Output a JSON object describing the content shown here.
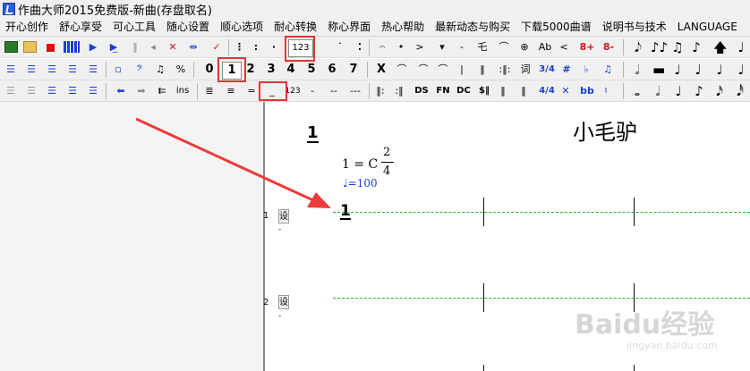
{
  "window": {
    "title": "作曲大师2015免费版-新曲(存盘取名)"
  },
  "menu": {
    "items": [
      "开心创作",
      "舒心享受",
      "可心工具",
      "随心设置",
      "顺心选项",
      "耐心转换",
      "称心界面",
      "热心帮助",
      "最新动态与购买",
      "下载5000曲谱",
      "说明书与技术",
      "LANGUAGE"
    ]
  },
  "toolbar1": {
    "colon_mark": ":",
    "jianpu_123": "123",
    "ab_label": "Ab",
    "lt_label": "<",
    "eight_plus": "8+",
    "eight_minus": "8-",
    "dash_label": "-",
    "wave_label": "乇"
  },
  "toolbar2": {
    "digits": [
      "0",
      "1",
      "2",
      "3",
      "4",
      "5",
      "6",
      "7"
    ],
    "x_label": "X",
    "ci_label": "词",
    "meter_label": "3/4",
    "sharp_label": "#",
    "flat_label": "♭"
  },
  "toolbar3": {
    "ins_label": "ins",
    "num_label": "123",
    "dash_single": "-",
    "dash_double": "--",
    "dash_triple": "---",
    "ds_label": "DS",
    "fn_label": "FN",
    "dc_label": "DC",
    "dollar_label": "$‖",
    "meter44": "4/4",
    "bb_label": "bb",
    "natural_label": "♮"
  },
  "score": {
    "page_number": "1",
    "title": "小毛驴",
    "key": "1 = C",
    "time_sig_top": "2",
    "time_sig_bottom": "4",
    "tempo_prefix": "♩=100",
    "first_note": "1",
    "rows": [
      {
        "num": "1",
        "button": "设"
      },
      {
        "num": "2",
        "button": "设"
      }
    ]
  },
  "watermark": {
    "brand": "Baidu经验",
    "url": "jingyan.baidu.com"
  },
  "colors": {
    "highlight": "#e53535",
    "arrow": "#ee3b3b",
    "staff_line": "#22bb22",
    "accent_blue": "#1a3fd0"
  }
}
